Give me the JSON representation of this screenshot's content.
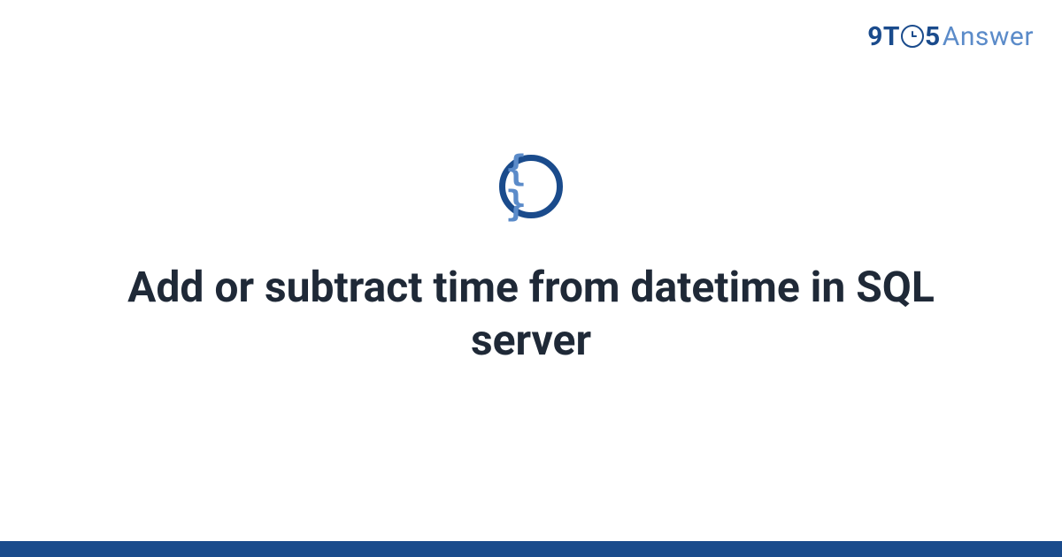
{
  "logo": {
    "part1": "9T",
    "clock_inner": "()",
    "part2": "5",
    "part3": "Answer"
  },
  "icon": {
    "braces": "{ }"
  },
  "title": "Add or subtract time from datetime in SQL server",
  "colors": {
    "primary": "#1a4b8c",
    "secondary": "#5b8bc9",
    "text": "#1f2937"
  }
}
